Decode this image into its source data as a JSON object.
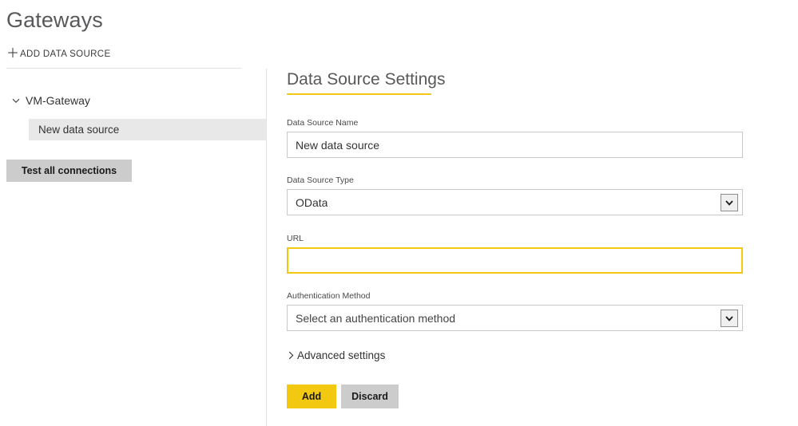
{
  "page": {
    "title": "Gateways"
  },
  "left_panel": {
    "add_data_source": {
      "label": "ADD DATA SOURCE",
      "icon": "plus-icon"
    },
    "tree": {
      "groups": [
        {
          "label": "VM-Gateway",
          "expanded": true,
          "chevron_icon": "chevron-down-icon",
          "items": [
            {
              "label": "New data source",
              "selected": true
            }
          ]
        }
      ]
    },
    "test_all_connections_label": "Test all connections"
  },
  "right_panel": {
    "title": "Data Source Settings",
    "fields": {
      "data_source_name": {
        "label": "Data Source Name",
        "value": "New data source",
        "placeholder": ""
      },
      "data_source_type": {
        "label": "Data Source Type",
        "value": "OData",
        "chevron_icon": "chevron-down-icon"
      },
      "url": {
        "label": "URL",
        "value": "",
        "placeholder": "",
        "focused": true
      },
      "authentication_method": {
        "label": "Authentication Method",
        "value": "Select an authentication method",
        "chevron_icon": "chevron-down-icon"
      }
    },
    "advanced_settings": {
      "label": "Advanced settings",
      "chevron_icon": "chevron-right-icon",
      "expanded": false
    },
    "actions": {
      "add_label": "Add",
      "discard_label": "Discard"
    }
  },
  "colors": {
    "accent_yellow": "#f2c811",
    "button_gray": "#cccccc",
    "selected_row": "#e8e8e8",
    "border_gray": "#c8c8c8",
    "divider": "#e2e2e2",
    "title_gray": "#58595b"
  }
}
